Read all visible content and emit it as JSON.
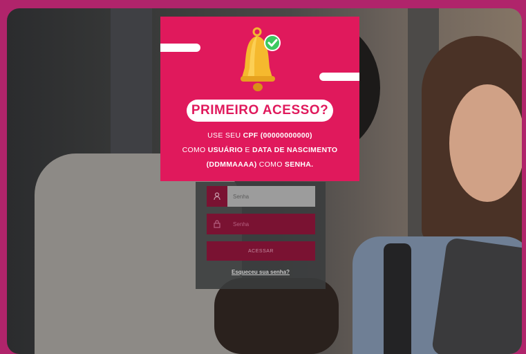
{
  "login": {
    "user_placeholder": "Senha",
    "pass_placeholder": "Senha",
    "submit_label": "ACESSAR",
    "forgot_link": "Esqueceu sua senha?"
  },
  "modal": {
    "title": "PRIMEIRO ACESSO?",
    "line1_prefix": "USE SEU ",
    "line1_bold": "CPF (00000000000)",
    "line2_prefix": "COMO ",
    "line2_bold1": "USUÁRIO",
    "line2_mid": " E ",
    "line2_bold2": "DATA DE NASCIMENTO",
    "line3_bold1": "(DDMMAAAA)",
    "line3_mid": " COMO ",
    "line3_bold2": "SENHA."
  },
  "colors": {
    "brand": "#e0195c",
    "frame": "#b0246b",
    "field": "#7a1232"
  },
  "icons": {
    "bell": "bell-icon",
    "check": "check-badge-icon",
    "user": "user-icon",
    "lock": "lock-icon"
  }
}
